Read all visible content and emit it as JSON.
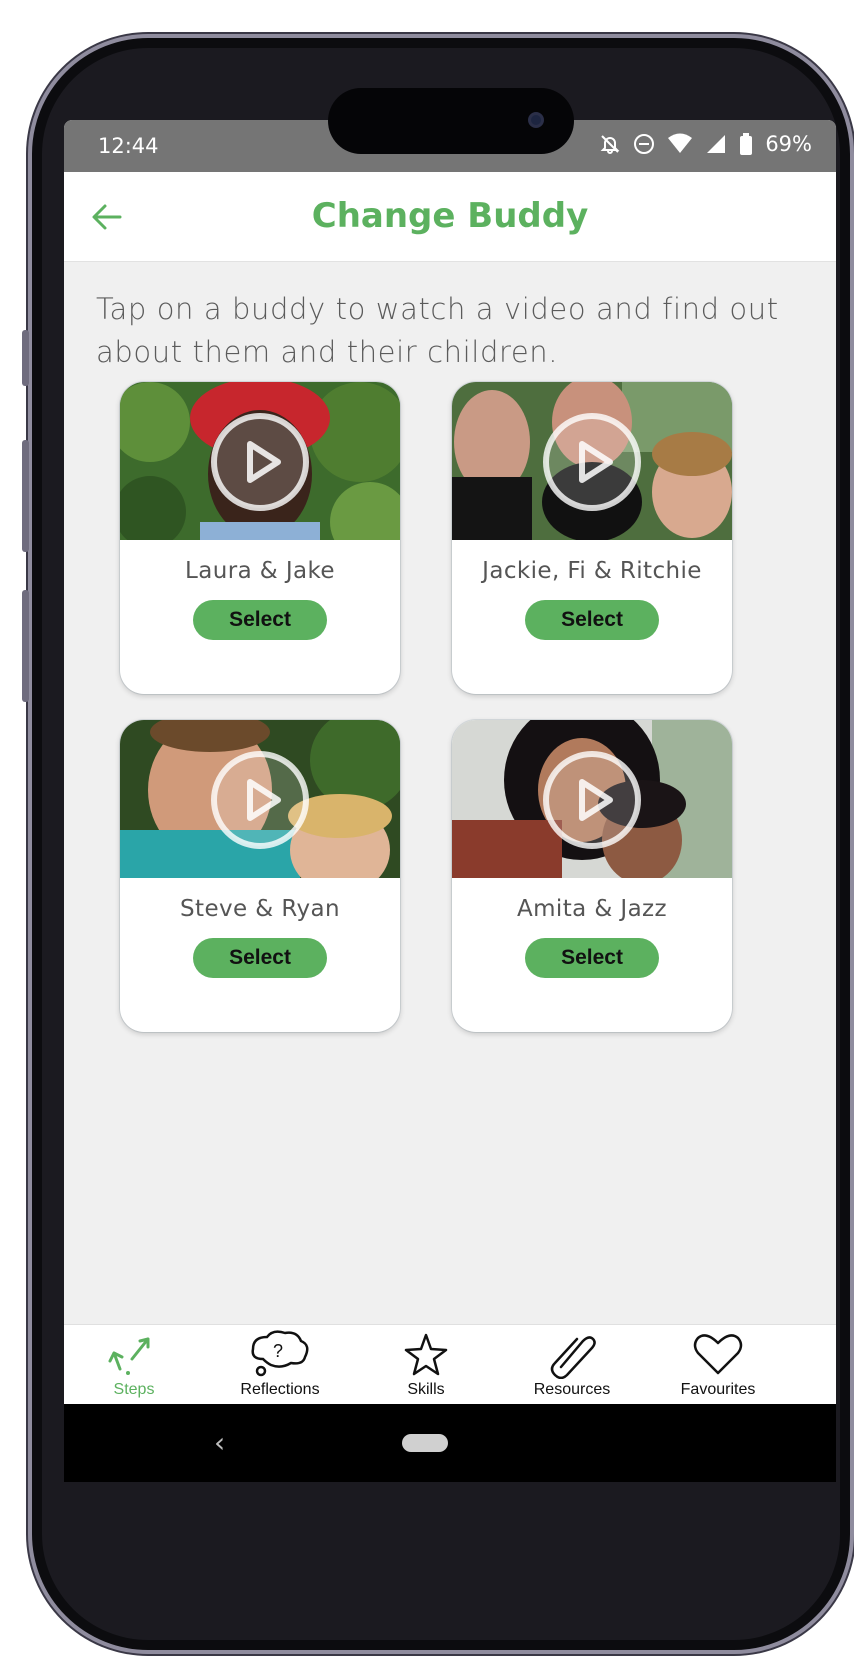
{
  "status_bar": {
    "time": "12:44",
    "battery": "69%",
    "icons": [
      "bell-off-icon",
      "do-not-disturb-icon",
      "wifi-icon",
      "signal-icon",
      "battery-icon"
    ]
  },
  "app_bar": {
    "title": "Change Buddy",
    "back_icon": "arrow-left-icon"
  },
  "intro_text": "Tap on a buddy to watch a video and find out about them and their children.",
  "buddies": [
    {
      "name": "Laura & Jake",
      "select_label": "Select"
    },
    {
      "name": "Jackie, Fi & Ritchie",
      "select_label": "Select"
    },
    {
      "name": "Steve & Ryan",
      "select_label": "Select"
    },
    {
      "name": "Amita & Jazz",
      "select_label": "Select"
    }
  ],
  "bottom_nav": [
    {
      "label": "Steps",
      "icon": "steps-arrows-icon",
      "active": true
    },
    {
      "label": "Reflections",
      "icon": "thought-bubble-question-icon",
      "active": false
    },
    {
      "label": "Skills",
      "icon": "star-icon",
      "active": false
    },
    {
      "label": "Resources",
      "icon": "paperclip-icon",
      "active": false
    },
    {
      "label": "Favourites",
      "icon": "heart-icon",
      "active": false
    }
  ],
  "colors": {
    "accent": "#5cb15f",
    "status_bar": "#757575",
    "background": "#f0f0f0"
  }
}
